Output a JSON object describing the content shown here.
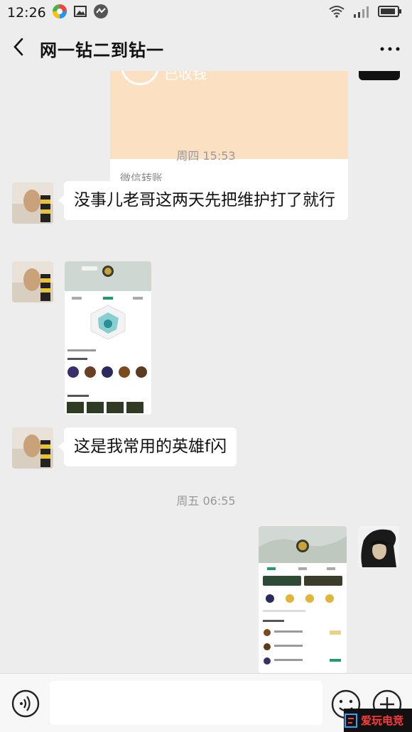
{
  "status_bar": {
    "time": "12:26"
  },
  "nav": {
    "title": "网一钻二到钻一"
  },
  "transfer": {
    "status": "已收钱",
    "footer": "微信转账"
  },
  "timestamps": [
    "周四 15:53",
    "周五 06:55"
  ],
  "messages": [
    {
      "text": "没事儿老哥这两天先把维护打了就行"
    },
    {
      "text": "这是我常用的英雄f闪"
    }
  ],
  "screenshot1": {
    "player_name": "只是萧入",
    "tabs": [
      "战绩",
      "能力",
      "资产"
    ],
    "hero_section": "最近常用英雄",
    "record_section": "游戏战绩",
    "stats": [
      "17",
      "62",
      "16",
      "65"
    ]
  },
  "screenshot2": {
    "player_name": "只是萧入",
    "tabs": [
      "战绩",
      "能力",
      "资产"
    ],
    "section": "全部战绩"
  },
  "watermark": {
    "text": "爱玩电竞"
  },
  "colors": {
    "background": "#ededed",
    "bubble": "#ffffff",
    "transfer_orange": "#fbe1c2",
    "game_green": "#1f9d62"
  }
}
